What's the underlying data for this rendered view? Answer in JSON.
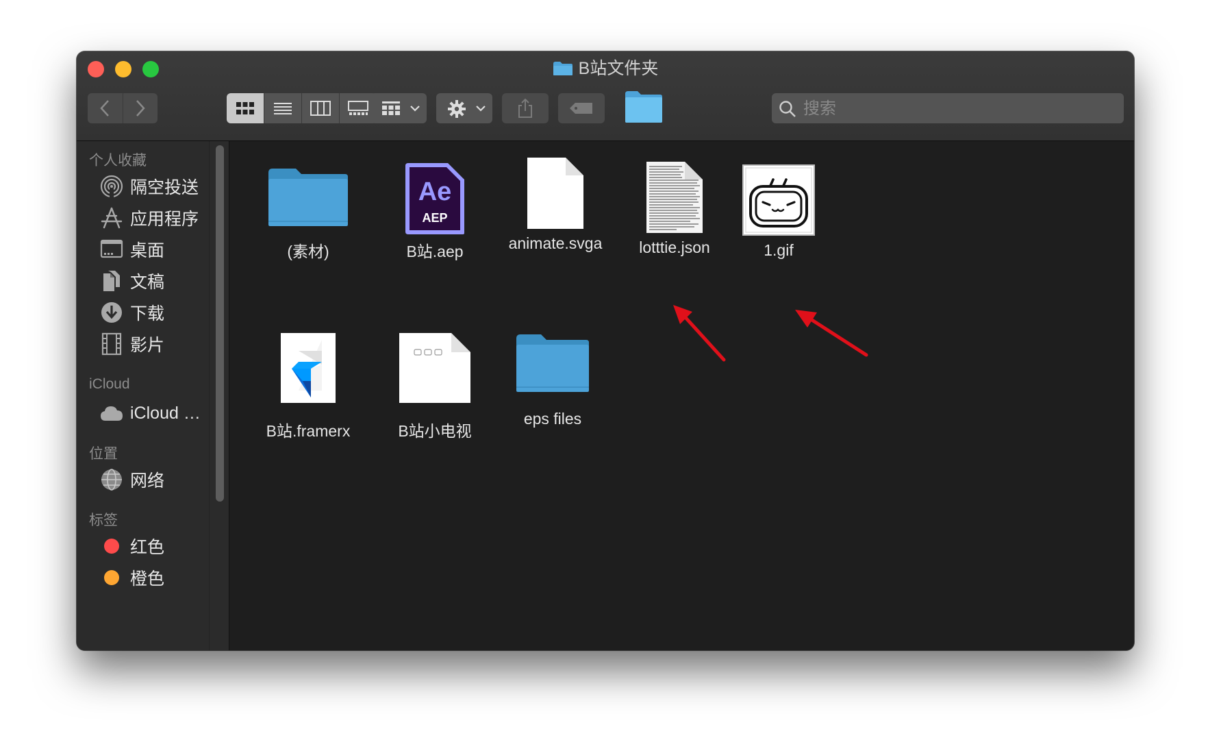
{
  "window": {
    "title": "B站文件夹"
  },
  "toolbar": {
    "back_icon": "chevron-left-icon",
    "forward_icon": "chevron-right-icon",
    "views": [
      "icon-view",
      "list-view",
      "column-view",
      "gallery-view"
    ],
    "search_placeholder": "搜索"
  },
  "sidebar": {
    "sections": [
      {
        "title": "个人收藏",
        "items": [
          {
            "label": "隔空投送",
            "icon": "airdrop-icon"
          },
          {
            "label": "应用程序",
            "icon": "applications-icon"
          },
          {
            "label": "桌面",
            "icon": "desktop-icon"
          },
          {
            "label": "文稿",
            "icon": "documents-icon"
          },
          {
            "label": "下载",
            "icon": "downloads-icon"
          },
          {
            "label": "影片",
            "icon": "movies-icon"
          }
        ]
      },
      {
        "title": "iCloud",
        "items": [
          {
            "label": "iCloud …",
            "icon": "icloud-icon"
          }
        ]
      },
      {
        "title": "位置",
        "items": [
          {
            "label": "网络",
            "icon": "network-icon"
          }
        ]
      },
      {
        "title": "标签",
        "items": [
          {
            "label": "红色",
            "icon": "tag-dot-icon",
            "color": "#fe4b4b"
          },
          {
            "label": "橙色",
            "icon": "tag-dot-icon",
            "color": "#fea632"
          }
        ]
      }
    ]
  },
  "files": [
    {
      "name": "(素材)",
      "type": "folder"
    },
    {
      "name": "B站.aep",
      "type": "aep",
      "icon_text": "Ae",
      "icon_subtext": "AEP"
    },
    {
      "name": "animate.svga",
      "type": "document"
    },
    {
      "name": "lotttie.json",
      "type": "text-document"
    },
    {
      "name": "1.gif",
      "type": "gif"
    },
    {
      "name": "B站.framerx",
      "type": "framer"
    },
    {
      "name": "B站小电视",
      "type": "document-preview"
    },
    {
      "name": "eps files",
      "type": "folder"
    }
  ],
  "colors": {
    "folder": "#4da3d9",
    "ae_purple": "#9999ff",
    "ae_bg": "#2a0a3f",
    "annotation_arrow": "#e0101a"
  }
}
